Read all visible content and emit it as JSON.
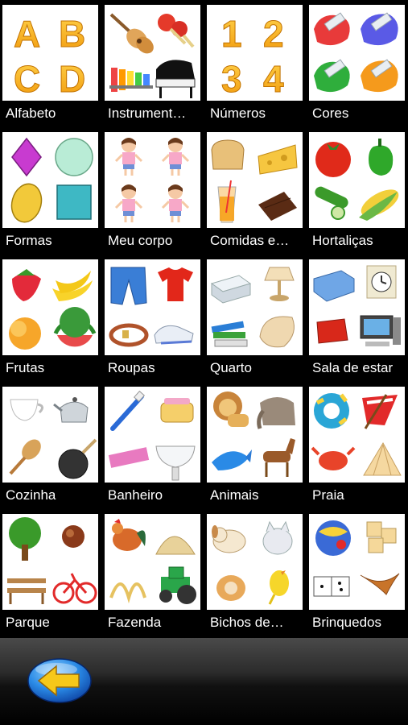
{
  "categories": [
    {
      "label": "Alfabeto",
      "icon": "alphabet-letters-icon"
    },
    {
      "label": "Instrument…",
      "icon": "musical-instruments-icon"
    },
    {
      "label": "Números",
      "icon": "numbers-icon"
    },
    {
      "label": "Cores",
      "icon": "paint-tubes-icon"
    },
    {
      "label": "Formas",
      "icon": "shapes-icon"
    },
    {
      "label": "Meu corpo",
      "icon": "body-girl-icon"
    },
    {
      "label": "Comidas e…",
      "icon": "food-drinks-icon"
    },
    {
      "label": "Hortaliças",
      "icon": "vegetables-icon"
    },
    {
      "label": "Frutas",
      "icon": "fruits-icon"
    },
    {
      "label": "Roupas",
      "icon": "clothes-icon"
    },
    {
      "label": "Quarto",
      "icon": "bedroom-icon"
    },
    {
      "label": "Sala de estar",
      "icon": "living-room-icon"
    },
    {
      "label": "Cozinha",
      "icon": "kitchen-icon"
    },
    {
      "label": "Banheiro",
      "icon": "bathroom-icon"
    },
    {
      "label": "Animais",
      "icon": "animals-icon"
    },
    {
      "label": "Praia",
      "icon": "beach-icon"
    },
    {
      "label": "Parque",
      "icon": "park-icon"
    },
    {
      "label": "Fazenda",
      "icon": "farm-icon"
    },
    {
      "label": "Bichos de…",
      "icon": "pets-icon"
    },
    {
      "label": "Brinquedos",
      "icon": "toys-icon"
    }
  ],
  "thumb_text": {
    "letters": [
      "A",
      "B",
      "C",
      "D"
    ],
    "digits": [
      "1",
      "2",
      "3",
      "4"
    ]
  },
  "back_button": {
    "icon": "back-arrow-icon"
  }
}
